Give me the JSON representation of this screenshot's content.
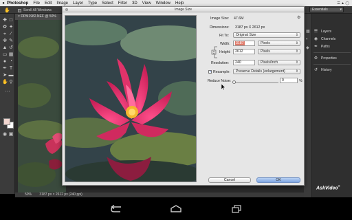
{
  "menubar": {
    "app": "Photoshop",
    "items": [
      "File",
      "Edit",
      "Image",
      "Layer",
      "Type",
      "Select",
      "Filter",
      "3D",
      "View",
      "Window",
      "Help"
    ]
  },
  "options_bar": {
    "scroll_all_windows": "Scroll All Windows",
    "workspace": "Essentials"
  },
  "document": {
    "tab_title": "DPM1982.NEF @ 50%",
    "status_zoom": "50%",
    "status_dims": "3187 px × 2612 px (240 ppi)"
  },
  "right_panels": [
    {
      "label": "Layers",
      "icon": "layers-icon"
    },
    {
      "label": "Channels",
      "icon": "channels-icon"
    },
    {
      "label": "Paths",
      "icon": "paths-icon"
    },
    {
      "label": "Properties",
      "icon": "properties-icon"
    },
    {
      "label": "History",
      "icon": "history-icon"
    }
  ],
  "brand": {
    "name": "AskVideo"
  },
  "dialog": {
    "title": "Image Size",
    "image_size_label": "Image Size:",
    "image_size_value": "47.6M",
    "dimensions_label": "Dimensions:",
    "dimensions_value": "3187 px  X  2612 px",
    "fit_to_label": "Fit To:",
    "fit_to_value": "Original Size",
    "width_label": "Width:",
    "width_value": "3187",
    "width_unit": "Pixels",
    "height_label": "Height:",
    "height_value": "2612",
    "height_unit": "Pixels",
    "resolution_label": "Resolution:",
    "resolution_value": "240",
    "resolution_unit": "Pixels/Inch",
    "resample_label": "Resample:",
    "resample_checked": true,
    "resample_value": "Preserve Details (enlargement)",
    "reduce_noise_label": "Reduce Noise:",
    "reduce_noise_value": "0",
    "reduce_noise_unit": "%",
    "cancel_label": "Cancel",
    "ok_label": "OK"
  },
  "colors": {
    "dialog_bg": "#e6e6e6",
    "ok_button": "#7ea6e2",
    "width_highlight": "#e07a6a",
    "foreground_swatch": "#f2d6d0"
  }
}
